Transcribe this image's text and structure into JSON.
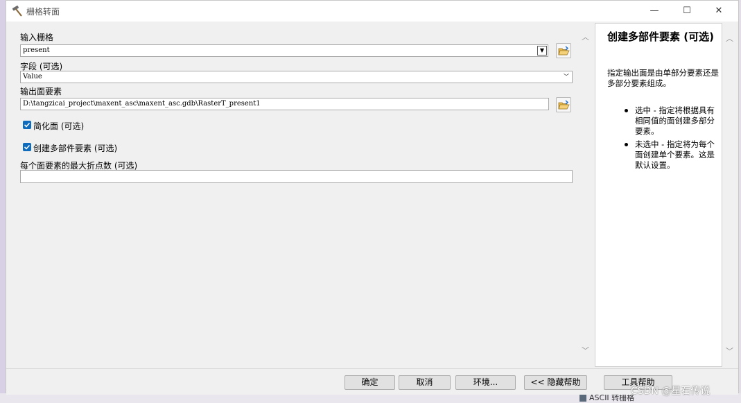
{
  "background": {
    "taskbar_item": "ASCII 转栅格"
  },
  "window": {
    "title": "栅格转面",
    "controls": {
      "minimize": "—",
      "maximize": "☐",
      "close": "✕"
    }
  },
  "form": {
    "input_raster": {
      "label": "输入栅格",
      "value": "present"
    },
    "field": {
      "label": "字段 (可选)",
      "value": "Value"
    },
    "output_features": {
      "label": "输出面要素",
      "value": "D:\\tangzicai_project\\maxent_asc\\maxent_asc.gdb\\RasterT_present1"
    },
    "simplify": {
      "label": "简化面 (可选)",
      "checked": true
    },
    "multipart": {
      "label": "创建多部件要素 (可选)",
      "checked": true
    },
    "max_vertices": {
      "label": "每个面要素的最大折点数 (可选)",
      "value": ""
    }
  },
  "help": {
    "title": "创建多部件要素 (可选)",
    "description": "指定输出面是由单部分要素还是多部分要素组成。",
    "items": [
      "选中 - 指定将根据具有相同值的面创建多部分要素。",
      "未选中 - 指定将为每个面创建单个要素。这是默认设置。"
    ]
  },
  "buttons": {
    "ok": "确定",
    "cancel": "取消",
    "environments": "环境...",
    "hide_help": "<< 隐藏帮助",
    "tool_help": "工具帮助"
  },
  "watermark": "CSDN @星石传说",
  "colors": {
    "accent": "#0f6cbd",
    "panel": "#f0f0f0"
  }
}
